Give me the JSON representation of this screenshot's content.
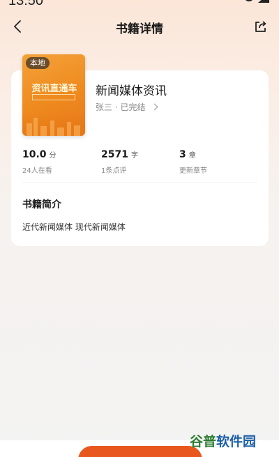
{
  "status_bar": {
    "time": "13:50"
  },
  "nav": {
    "title": "书籍详情"
  },
  "book": {
    "cover_badge": "本地",
    "cover_title": "资讯直通车",
    "title": "新闻媒体资讯",
    "author_status": "张三 · 已完结"
  },
  "stats": [
    {
      "value": "10.0",
      "unit": "分",
      "label": "24人在看"
    },
    {
      "value": "2571",
      "unit": "字",
      "label": "1条点评"
    },
    {
      "value": "3",
      "unit": "章",
      "label": "更新章节"
    }
  ],
  "intro": {
    "heading": "书籍简介",
    "text": "近代新闻媒体 现代新闻媒体"
  },
  "watermark": {
    "part1": "谷普",
    "part2": "软件园"
  },
  "colors": {
    "accent": "#e8581e",
    "cover": "#ee8a1e"
  }
}
